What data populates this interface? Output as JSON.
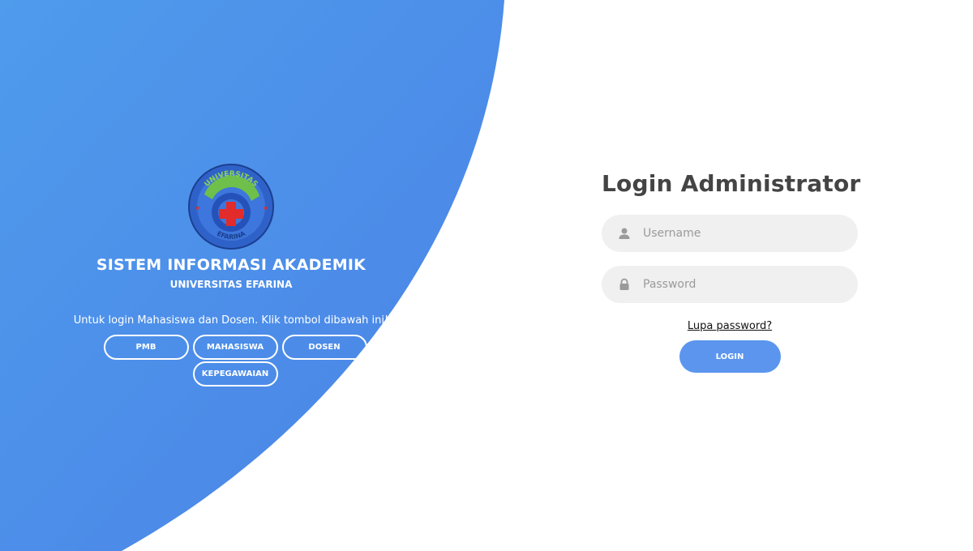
{
  "theme": {
    "primary_blue": "#4d8ae8",
    "blue_light": "#4f9bec",
    "login_button": "#5b95ee",
    "input_bg": "#f0f0f0",
    "title_color": "#444444"
  },
  "logo": {
    "top_text": "UNIVERSITAS",
    "bottom_text": "EFARINA"
  },
  "left": {
    "title": "SISTEM INFORMASI AKADEMIK",
    "subtitle": "UNIVERSITAS EFARINA",
    "instruction": "Untuk login Mahasiswa dan Dosen. Klik tombol dibawah ini!",
    "buttons": [
      {
        "label": "PMB"
      },
      {
        "label": "MAHASISWA"
      },
      {
        "label": "DOSEN"
      },
      {
        "label": "KEPEGAWAIAN"
      }
    ]
  },
  "login": {
    "title": "Login Administrator",
    "username_placeholder": "Username",
    "password_placeholder": "Password",
    "forgot_label": "Lupa password?",
    "submit_label": "LOGIN"
  },
  "icons": {
    "username": "user-icon",
    "password": "lock-icon"
  }
}
